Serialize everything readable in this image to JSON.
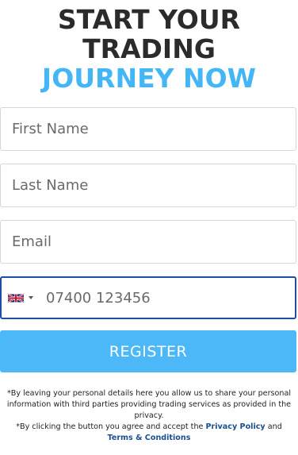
{
  "headline": {
    "line1": "START YOUR",
    "line2": "TRADING",
    "line3": "JOURNEY NOW"
  },
  "colors": {
    "heading_dark": "#2b2b2b",
    "accent_blue": "#45b6f5",
    "button_blue": "#4cb8f7",
    "link_blue": "#1a4f8f",
    "phone_border": "#1d4fa0"
  },
  "form": {
    "first_name": {
      "placeholder": "First Name",
      "value": ""
    },
    "last_name": {
      "placeholder": "Last Name",
      "value": ""
    },
    "email": {
      "placeholder": "Email",
      "value": ""
    },
    "phone": {
      "country_icon": "uk-flag-icon",
      "dropdown_icon": "caret-down-icon",
      "placeholder": "07400 123456",
      "value": ""
    },
    "register_label": "REGISTER"
  },
  "disclaimer": {
    "line1": "*By leaving your personal details here you allow us to share your personal information with third parties providing trading services as provided in the privacy.",
    "line2_prefix": "*By clicking the button you agree and accept the ",
    "privacy_link": "Privacy Policy",
    "and": " and ",
    "terms_link": "Terms & Conditions"
  }
}
